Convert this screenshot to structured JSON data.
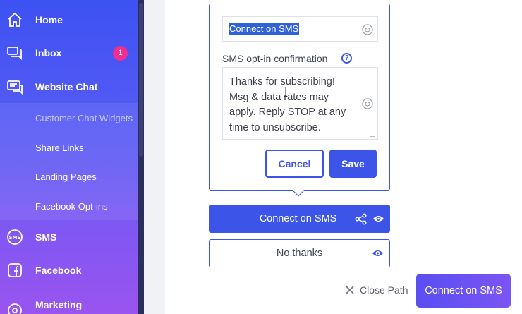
{
  "sidebar": {
    "items": [
      {
        "label": "Home",
        "icon": "home-icon"
      },
      {
        "label": "Inbox",
        "icon": "inbox-icon",
        "badge": "1"
      },
      {
        "label": "Website Chat",
        "icon": "website-chat-icon"
      },
      {
        "label": "SMS",
        "icon": "sms-icon"
      },
      {
        "label": "Facebook",
        "icon": "facebook-icon"
      },
      {
        "label": "Marketing",
        "icon": "marketing-icon"
      }
    ],
    "subitems": [
      {
        "label": "Customer Chat Widgets",
        "active": true
      },
      {
        "label": "Share Links"
      },
      {
        "label": "Landing Pages"
      },
      {
        "label": "Facebook Opt-ins"
      }
    ]
  },
  "editor": {
    "button_text_value": "Connect on SMS",
    "optin_label": "SMS opt-in confirmation",
    "help_glyph": "?",
    "optin_message": "Thanks for subscribing! Msg & data rates may apply. Reply STOP at any time to unsubscribe.",
    "cancel_label": "Cancel",
    "save_label": "Save"
  },
  "preview": {
    "primary_label": "Connect on SMS",
    "secondary_label": "No thanks"
  },
  "footer": {
    "close_path_label": "Close Path",
    "connect_label": "Connect on SMS"
  },
  "colors": {
    "accent": "#3d54e8",
    "badge": "#ef2e8f",
    "selection": "#2f62d9"
  }
}
